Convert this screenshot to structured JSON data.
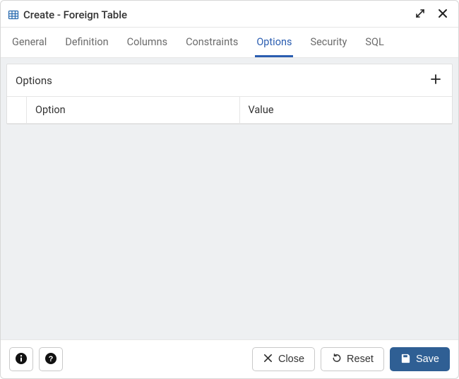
{
  "dialog": {
    "title": "Create - Foreign Table"
  },
  "tabs": [
    {
      "label": "General",
      "active": false
    },
    {
      "label": "Definition",
      "active": false
    },
    {
      "label": "Columns",
      "active": false
    },
    {
      "label": "Constraints",
      "active": false
    },
    {
      "label": "Options",
      "active": true
    },
    {
      "label": "Security",
      "active": false
    },
    {
      "label": "SQL",
      "active": false
    }
  ],
  "panel": {
    "title": "Options",
    "columns": {
      "option": "Option",
      "value": "Value"
    },
    "rows": []
  },
  "footer": {
    "close": "Close",
    "reset": "Reset",
    "save": "Save"
  }
}
